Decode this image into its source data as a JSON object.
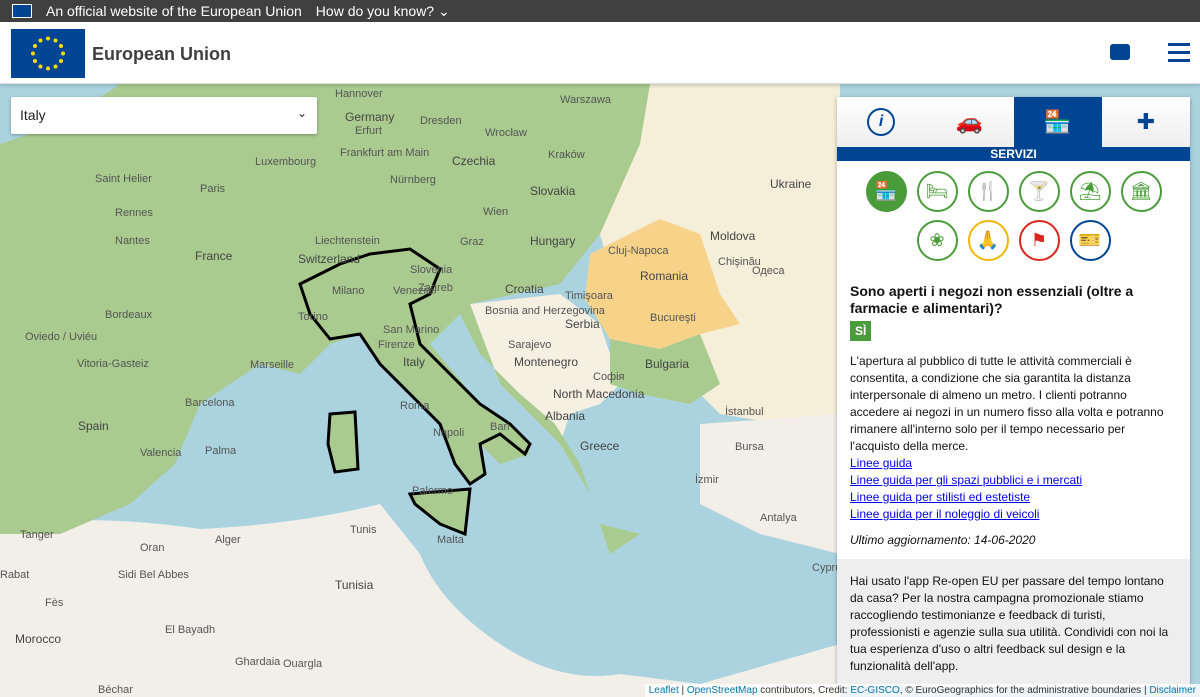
{
  "topbar": {
    "official_text": "An official website of the European Union",
    "how_know": "How do you know?"
  },
  "header": {
    "title": "European Union"
  },
  "country_select": {
    "value": "Italy"
  },
  "map_labels": [
    {
      "t": "Hannover",
      "c": "lbl"
    },
    {
      "t": "Warszawa",
      "c": "lbl"
    },
    {
      "t": "Germany",
      "c": "lbl big"
    },
    {
      "t": "Erfurt",
      "c": "lbl"
    },
    {
      "t": "Dresden",
      "c": "lbl"
    },
    {
      "t": "Wrocław",
      "c": "lbl"
    },
    {
      "t": "Kraków",
      "c": "lbl"
    },
    {
      "t": "Luxembourg",
      "c": "lbl"
    },
    {
      "t": "Frankfurt am Main",
      "c": "lbl"
    },
    {
      "t": "Czechia",
      "c": "lbl big"
    },
    {
      "t": "Paris",
      "c": "lbl"
    },
    {
      "t": "Nürnberg",
      "c": "lbl"
    },
    {
      "t": "Slovakia",
      "c": "lbl big"
    },
    {
      "t": "Saint Helier",
      "c": "lbl"
    },
    {
      "t": "Rennes",
      "c": "lbl"
    },
    {
      "t": "Wien",
      "c": "lbl"
    },
    {
      "t": "Ukraine",
      "c": "lbl big"
    },
    {
      "t": "Nantes",
      "c": "lbl"
    },
    {
      "t": "France",
      "c": "lbl big"
    },
    {
      "t": "Liechtenstein",
      "c": "lbl"
    },
    {
      "t": "Graz",
      "c": "lbl"
    },
    {
      "t": "Hungary",
      "c": "lbl big"
    },
    {
      "t": "Moldova",
      "c": "lbl big"
    },
    {
      "t": "Switzerland",
      "c": "lbl big"
    },
    {
      "t": "Slovenia",
      "c": "lbl"
    },
    {
      "t": "Cluj-Napoca",
      "c": "lbl"
    },
    {
      "t": "Chişinău",
      "c": "lbl"
    },
    {
      "t": "Milano",
      "c": "lbl"
    },
    {
      "t": "Venezia",
      "c": "lbl"
    },
    {
      "t": "Zagreb",
      "c": "lbl"
    },
    {
      "t": "Croatia",
      "c": "lbl big"
    },
    {
      "t": "Romania",
      "c": "lbl big"
    },
    {
      "t": "Одеса",
      "c": "lbl"
    },
    {
      "t": "Bordeaux",
      "c": "lbl"
    },
    {
      "t": "Torino",
      "c": "lbl"
    },
    {
      "t": "Timişoara",
      "c": "lbl"
    },
    {
      "t": "San Marino",
      "c": "lbl"
    },
    {
      "t": "Bosnia and Herzegovina",
      "c": "lbl"
    },
    {
      "t": "Serbia",
      "c": "lbl big"
    },
    {
      "t": "Bucureşti",
      "c": "lbl"
    },
    {
      "t": "Oviedo / Uviéu",
      "c": "lbl"
    },
    {
      "t": "Firenze",
      "c": "lbl"
    },
    {
      "t": "Sarajevo",
      "c": "lbl"
    },
    {
      "t": "Italy",
      "c": "lbl big"
    },
    {
      "t": "Montenegro",
      "c": "lbl big"
    },
    {
      "t": "Bulgaria",
      "c": "lbl big"
    },
    {
      "t": "Vitoria-Gasteiz",
      "c": "lbl"
    },
    {
      "t": "Marseille",
      "c": "lbl"
    },
    {
      "t": "Софія",
      "c": "lbl"
    },
    {
      "t": "Barcelona",
      "c": "lbl"
    },
    {
      "t": "Roma",
      "c": "lbl"
    },
    {
      "t": "North Macedonia",
      "c": "lbl big"
    },
    {
      "t": "Spain",
      "c": "lbl big"
    },
    {
      "t": "Albania",
      "c": "lbl big"
    },
    {
      "t": "İstanbul",
      "c": "lbl"
    },
    {
      "t": "Napoli",
      "c": "lbl"
    },
    {
      "t": "Bari",
      "c": "lbl"
    },
    {
      "t": "Valencia",
      "c": "lbl"
    },
    {
      "t": "Palma",
      "c": "lbl"
    },
    {
      "t": "Greece",
      "c": "lbl big"
    },
    {
      "t": "Bursa",
      "c": "lbl"
    },
    {
      "t": "Palermo",
      "c": "lbl"
    },
    {
      "t": "İzmir",
      "c": "lbl"
    },
    {
      "t": "Tanger",
      "c": "lbl"
    },
    {
      "t": "Alger",
      "c": "lbl"
    },
    {
      "t": "Tunis",
      "c": "lbl"
    },
    {
      "t": "Malta",
      "c": "lbl"
    },
    {
      "t": "Antalya",
      "c": "lbl"
    },
    {
      "t": "Oran",
      "c": "lbl"
    },
    {
      "t": "Rabat",
      "c": "lbl"
    },
    {
      "t": "Sidi Bel Abbes",
      "c": "lbl"
    },
    {
      "t": "Tunisia",
      "c": "lbl big"
    },
    {
      "t": "Fès",
      "c": "lbl"
    },
    {
      "t": "Morocco",
      "c": "lbl big"
    },
    {
      "t": "El Bayadh",
      "c": "lbl"
    },
    {
      "t": "Ghardaia",
      "c": "lbl"
    },
    {
      "t": "Ouargla",
      "c": "lbl"
    },
    {
      "t": "Béchar",
      "c": "lbl"
    },
    {
      "t": "Cyprus",
      "c": "lbl"
    }
  ],
  "panel": {
    "tabs": [
      {
        "name": "info",
        "icon": "i"
      },
      {
        "name": "transport",
        "icon": "🚗"
      },
      {
        "name": "services",
        "icon": "🏪"
      },
      {
        "name": "health",
        "icon": "✚"
      }
    ],
    "section_title": "SERVIZI",
    "categories_row1": [
      {
        "name": "shops",
        "icon": "🏪",
        "cls": "cat active"
      },
      {
        "name": "accommodation",
        "icon": "🛏",
        "cls": "cat"
      },
      {
        "name": "restaurants",
        "icon": "🍴",
        "cls": "cat"
      },
      {
        "name": "bars",
        "icon": "🍸",
        "cls": "cat"
      },
      {
        "name": "beaches",
        "icon": "⛱",
        "cls": "cat"
      },
      {
        "name": "museums",
        "icon": "🏛",
        "cls": "cat"
      }
    ],
    "categories_row2": [
      {
        "name": "wellness",
        "icon": "❀",
        "cls": "cat"
      },
      {
        "name": "worship",
        "icon": "🙏",
        "cls": "cat yellow"
      },
      {
        "name": "tourist-guides",
        "icon": "⚑",
        "cls": "cat red"
      },
      {
        "name": "events",
        "icon": "🎫",
        "cls": "cat blue"
      }
    ],
    "question": "Sono aperti i negozi non essenziali (oltre a farmacie e alimentari)?",
    "answer": "SÌ",
    "body": "L'apertura al pubblico di tutte le attività commerciali è consentita, a condizione che sia garantita la distanza interpersonale di almeno un metro. I clienti potranno accedere ai negozi in un numero fisso alla volta e potranno rimanere all'interno solo per il tempo necessario per l'acquisto della merce.",
    "links": [
      "Linee guida",
      "Linee guida per gli spazi pubblici e i mercati",
      "Linee guida per stilisti ed estetiste",
      "Linee guida per il noleggio di veicoli"
    ],
    "updated": "Ultimo aggiornamento: 14-06-2020",
    "promo": "Hai usato l'app Re-open EU per passare del tempo lontano da casa? Per la nostra campagna promozionale stiamo raccogliendo testimonianze e feedback di turisti, professionisti e agenzie sulla sua utilità. Condividi con noi la tua esperienza d'uso o altri feedback sul design e la funzionalità dell'app."
  },
  "attribution": {
    "leaflet": "Leaflet",
    "osm": "OpenStreetMap",
    "text1": " contributors, Credit: ",
    "ecgisco": "EC-GISCO",
    "text2": ", © EuroGeographics for the administrative boundaries | ",
    "disclaimer": "Disclaimer"
  },
  "colors": {
    "eu_blue": "#004494",
    "green": "#4a9c3a",
    "land": "#a9cb8f",
    "romania": "#f7d38a",
    "sea": "#aad3df"
  }
}
